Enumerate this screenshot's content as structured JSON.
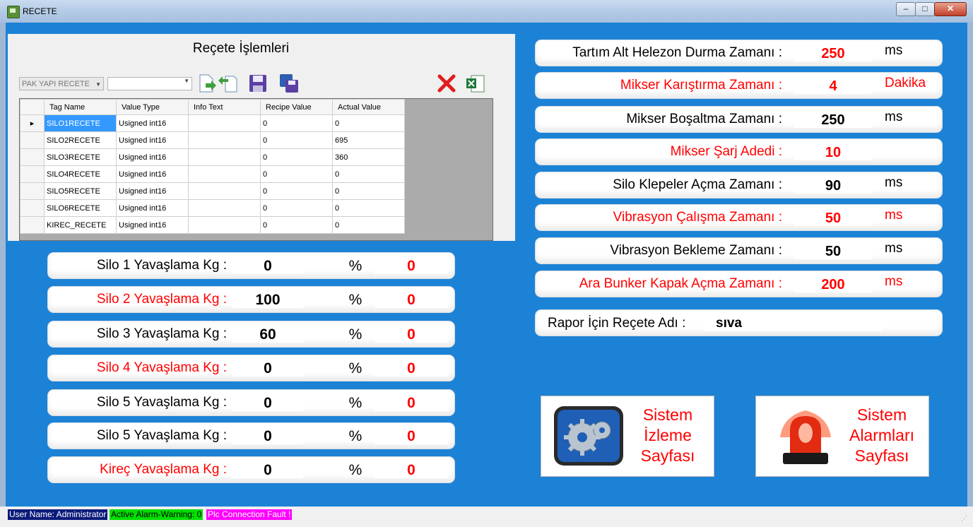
{
  "window": {
    "title": "RECETE",
    "min": "–",
    "max": "□",
    "close": "✕"
  },
  "recipe": {
    "title": "Reçete İşlemleri",
    "select_value": "PAK YAPI RECETE",
    "columns": [
      "Tag Name",
      "Value Type",
      "Info Text",
      "Recipe Value",
      "Actual Value"
    ],
    "rows": [
      [
        "SILO1RECETE",
        "Usigned int16",
        "",
        "0",
        "0"
      ],
      [
        "SILO2RECETE",
        "Usigned int16",
        "",
        "0",
        "695"
      ],
      [
        "SILO3RECETE",
        "Usigned int16",
        "",
        "0",
        "360"
      ],
      [
        "SILO4RECETE",
        "Usigned int16",
        "",
        "0",
        "0"
      ],
      [
        "SILO5RECETE",
        "Usigned int16",
        "",
        "0",
        "0"
      ],
      [
        "SILO6RECETE",
        "Usigned int16",
        "",
        "0",
        "0"
      ],
      [
        "KIREC_RECETE",
        "Usigned int16",
        "",
        "0",
        "0"
      ]
    ],
    "toolbar_icons": [
      "load-icon",
      "import-icon",
      "save-icon",
      "save-as-icon",
      "delete-icon",
      "excel-icon"
    ]
  },
  "silos": [
    {
      "label": "Silo 1 Yavaşlama Kg :",
      "value": "0",
      "pct": "%",
      "pct_value": "0",
      "label_color": "#000000"
    },
    {
      "label": "Silo 2 Yavaşlama Kg :",
      "value": "100",
      "pct": "%",
      "pct_value": "0",
      "label_color": "#ff0000"
    },
    {
      "label": "Silo 3 Yavaşlama Kg :",
      "value": "60",
      "pct": "%",
      "pct_value": "0",
      "label_color": "#000000"
    },
    {
      "label": "Silo 4 Yavaşlama Kg :",
      "value": "0",
      "pct": "%",
      "pct_value": "0",
      "label_color": "#ff0000"
    },
    {
      "label": "Silo 5 Yavaşlama Kg :",
      "value": "0",
      "pct": "%",
      "pct_value": "0",
      "label_color": "#000000"
    },
    {
      "label": "Silo 5 Yavaşlama Kg :",
      "value": "0",
      "pct": "%",
      "pct_value": "0",
      "label_color": "#000000"
    },
    {
      "label": "Kireç  Yavaşlama Kg :",
      "value": "0",
      "pct": "%",
      "pct_value": "0",
      "label_color": "#ff0000"
    }
  ],
  "params": [
    {
      "label": "Tartım Alt Helezon Durma Zamanı :",
      "value": "250",
      "unit": "ms",
      "label_color": "#000000",
      "value_color": "#ff0000"
    },
    {
      "label": "Mikser Karıştırma Zamanı :",
      "value": "4",
      "unit": "Dakika",
      "label_color": "#ff0000",
      "value_color": "#ff0000"
    },
    {
      "label": "Mikser Boşaltma Zamanı :",
      "value": "250",
      "unit": "ms",
      "label_color": "#000000",
      "value_color": "#000000"
    },
    {
      "label": "Mikser Şarj Adedi :",
      "value": "10",
      "unit": "",
      "label_color": "#ff0000",
      "value_color": "#ff0000"
    },
    {
      "label": "Silo Klepeler Açma Zamanı :",
      "value": "90",
      "unit": "ms",
      "label_color": "#000000",
      "value_color": "#000000"
    },
    {
      "label": "Vibrasyon Çalışma Zamanı :",
      "value": "50",
      "unit": "ms",
      "label_color": "#ff0000",
      "value_color": "#ff0000"
    },
    {
      "label": "Vibrasyon Bekleme Zamanı :",
      "value": "50",
      "unit": "ms",
      "label_color": "#000000",
      "value_color": "#000000"
    },
    {
      "label": "Ara Bunker Kapak Açma Zamanı :",
      "value": "200",
      "unit": "ms",
      "label_color": "#ff0000",
      "value_color": "#ff0000"
    }
  ],
  "report": {
    "label": "Rapor İçin Reçete Adı :",
    "value": "sıva"
  },
  "buttons": {
    "monitor": {
      "line1": "Sistem",
      "line2": "İzleme",
      "line3": "Sayfası",
      "icon": "gears-icon"
    },
    "alarm": {
      "line1": "Sistem",
      "line2": "Alarmları",
      "line3": "Sayfası",
      "icon": "alarm-light-icon"
    }
  },
  "status": {
    "user": "User Name: Administrator",
    "alarm": "Active Alarm-Warning: 0",
    "plc": "Plc Connection Fault !"
  }
}
